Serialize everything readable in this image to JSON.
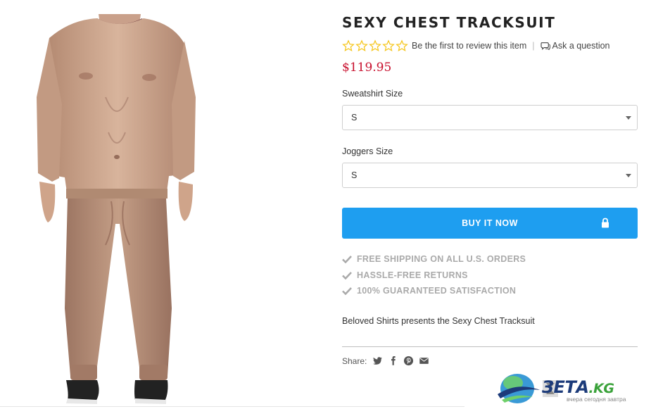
{
  "product": {
    "title": "SEXY CHEST TRACKSUIT",
    "rating": {
      "stars_filled": 0,
      "stars_total": 5,
      "review_text": "Be the first to review this item",
      "separator": "|"
    },
    "ask_question": "Ask a question",
    "price": "$119.95",
    "options": [
      {
        "label": "Sweatshirt Size",
        "selected": "S"
      },
      {
        "label": "Joggers Size",
        "selected": "S"
      }
    ],
    "buy_button": "BUY IT NOW",
    "features": [
      "FREE SHIPPING ON ALL U.S. ORDERS",
      "HASSLE-FREE RETURNS",
      "100% GUARANTEED SATISFACTION"
    ],
    "description": "Beloved Shirts presents the Sexy Chest Tracksuit",
    "share_label": "Share:",
    "share_icons": [
      "twitter-icon",
      "facebook-icon",
      "pinterest-icon",
      "email-icon"
    ]
  },
  "watermark": {
    "brand": "ЗЕТА",
    "domain": ".KG",
    "tagline": "вчера сегодня завтра"
  },
  "colors": {
    "accent": "#1e9ef0",
    "price": "#c8102e",
    "star": "#f5c518",
    "feature": "#aaaaaa"
  }
}
